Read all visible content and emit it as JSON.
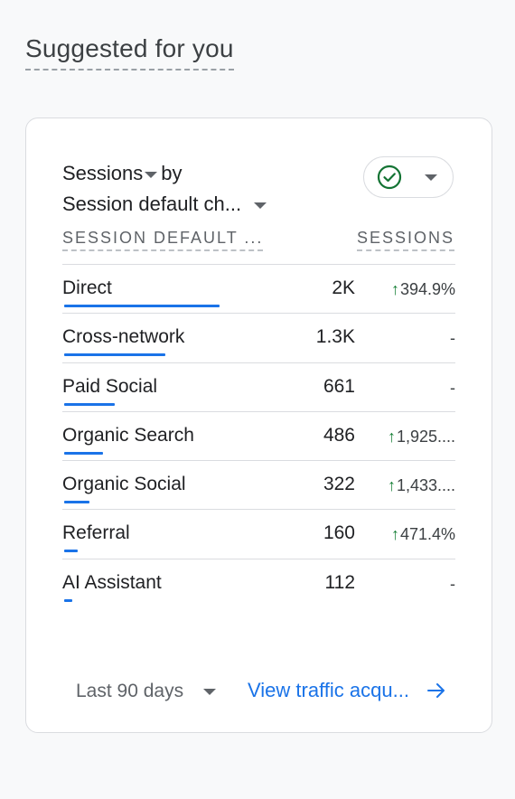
{
  "section": {
    "title": "Suggested for you"
  },
  "card": {
    "metric_title_line1": "Sessions",
    "metric_title_by": "by",
    "metric_title_line2": "Session default ch...",
    "status_icon": "check-circle-icon",
    "columns": {
      "dimension": "SESSION DEFAULT ...",
      "metric": "SESSIONS"
    },
    "rows": [
      {
        "label": "Direct",
        "value": "2K",
        "change": "394.9%",
        "up": true,
        "share": 0.4
      },
      {
        "label": "Cross-network",
        "value": "1.3K",
        "change": "-",
        "up": false,
        "share": 0.26
      },
      {
        "label": "Paid Social",
        "value": "661",
        "change": "-",
        "up": false,
        "share": 0.13
      },
      {
        "label": "Organic Search",
        "value": "486",
        "change": "1,925....",
        "up": true,
        "share": 0.1
      },
      {
        "label": "Organic Social",
        "value": "322",
        "change": "1,433....",
        "up": true,
        "share": 0.065
      },
      {
        "label": "Referral",
        "value": "160",
        "change": "471.4%",
        "up": true,
        "share": 0.035
      },
      {
        "label": "AI Assistant",
        "value": "112",
        "change": "-",
        "up": false,
        "share": 0.02
      }
    ],
    "footer": {
      "date_range": "Last 90 days",
      "link_label": "View traffic acqu...",
      "link_icon": "arrow-right-icon"
    }
  },
  "colors": {
    "accent": "#1a73e8",
    "positive": "#188038",
    "check": "#137333"
  }
}
